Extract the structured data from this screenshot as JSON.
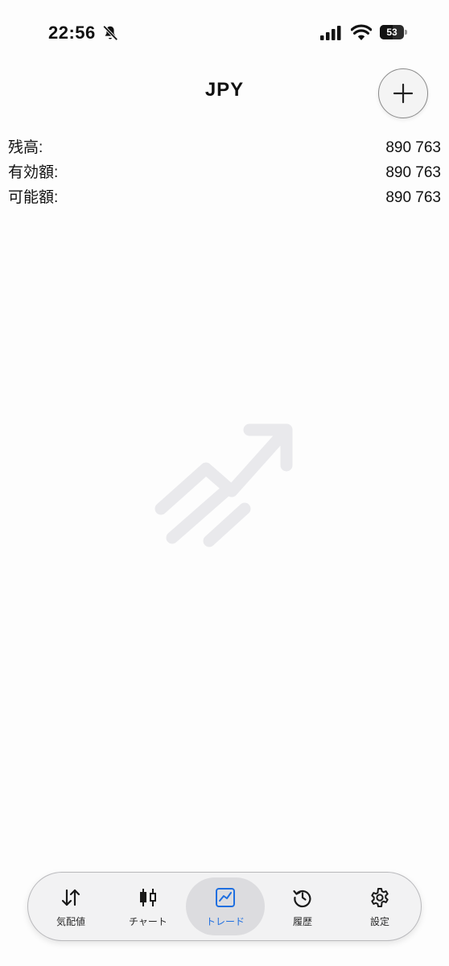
{
  "status_bar": {
    "time": "22:56",
    "battery": "53",
    "battery_level": 0.53,
    "icons": [
      "bell-slash-icon",
      "signal-icon",
      "wifi-icon",
      "battery-icon"
    ]
  },
  "header": {
    "title": "JPY",
    "add_icon": "plus-icon"
  },
  "account": {
    "rows": [
      {
        "label": "残高:",
        "value": "890 763"
      },
      {
        "label": "有効額:",
        "value": "890 763"
      },
      {
        "label": "可能額:",
        "value": "890 763"
      }
    ]
  },
  "empty_state": {
    "icon": "trending-up-icon"
  },
  "tab_bar": {
    "active_index": 2,
    "active_color": "#1f6fe0",
    "tabs": [
      {
        "label": "気配値",
        "icon": "quotes-arrows-icon"
      },
      {
        "label": "チャート",
        "icon": "candlestick-icon"
      },
      {
        "label": "トレード",
        "icon": "trade-chart-icon"
      },
      {
        "label": "履歴",
        "icon": "history-icon"
      },
      {
        "label": "設定",
        "icon": "settings-gear-icon"
      }
    ]
  }
}
